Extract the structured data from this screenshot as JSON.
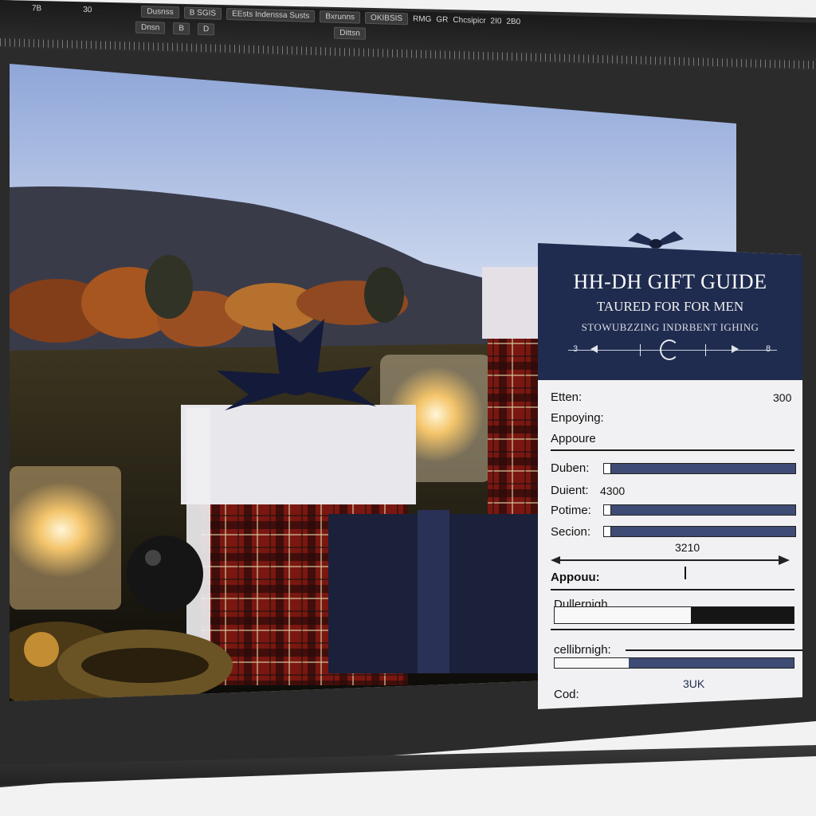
{
  "toolbar": {
    "items": [
      "Dusnss",
      "B SGIS",
      "EEsts Indenssa Susts",
      "Bxrunns",
      "OKIBSIS",
      "RMG",
      "GR",
      "Chcsipicr",
      "2I0",
      "2B0"
    ],
    "row2": [
      "Dnsn",
      "B",
      "D",
      "Dittsn"
    ],
    "left_numbers": [
      "7B",
      "30"
    ]
  },
  "card": {
    "title": "HH-DH GIFT GUIDE",
    "subtitle": "TAURED FOR FOR MEN",
    "tagline": "STOWUBZZING INDRBENT IGHING",
    "scale_left": "3",
    "scale_right": "8",
    "rows": {
      "etten_label": "Etten:",
      "etten_value": "300",
      "enpoying_label": "Enpoying:",
      "appoure_label": "Appoure",
      "duben_label": "Duben:",
      "duient_label": "Duient:",
      "duient_value": "4300",
      "potime_label": "Potime:",
      "secion_label": "Secion:",
      "range_value": "3210",
      "appouu_label": "Appouu:",
      "dullernigh_label": "Dullernigh",
      "cellibrnigh_label": "cellibrnigh:",
      "cod_label": "Cod:",
      "cod_value": "3UK"
    },
    "levels": {
      "dullernigh": 0.43,
      "cellibrnigh": 0.69
    }
  },
  "colors": {
    "card_header": "#1f2c4f",
    "bar_navy": "#3e4b75",
    "card_background": "#f1f1f3"
  },
  "icons": [
    "ribbon-bow-icon",
    "rotate-knob-icon",
    "arrow-left-icon",
    "arrow-right-icon"
  ]
}
